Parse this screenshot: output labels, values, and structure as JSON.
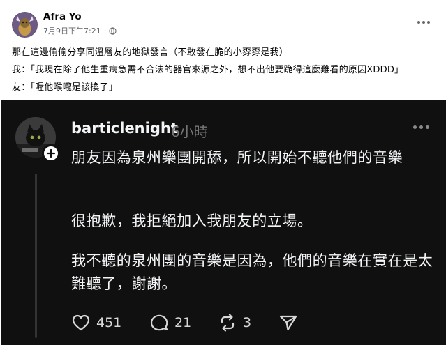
{
  "post": {
    "author": "Afra Yo",
    "timestamp": "7月9日下午7:21",
    "dot": "·",
    "privacy_icon": "globe-icon",
    "more_icon": "more-dots-icon",
    "lines": [
      "那在這邊偷偷分享同溫層友的地獄發言（不敢發在脆的小孬孬是我）",
      "我：「我現在除了他生重病急需不合法的器官來源之外，想不出他要跪得這麼難看的原因XDDD」",
      "友：「喔他喉嚨是該換了」"
    ]
  },
  "thread": {
    "username": "barticlenight",
    "time": "6小時",
    "paragraphs": [
      "朋友因為泉州樂團開舔，所以開始不聽他們的音樂",
      "很抱歉，我拒絕加入我朋友的立場。",
      "我不聽的泉州團的音樂是因為，他們的音樂在實在是太難聽了，謝謝。"
    ],
    "likes": "451",
    "comments": "21",
    "reposts": "3",
    "colors": {
      "background": "#101010",
      "text": "#f3f5f7",
      "muted": "#777777"
    }
  }
}
